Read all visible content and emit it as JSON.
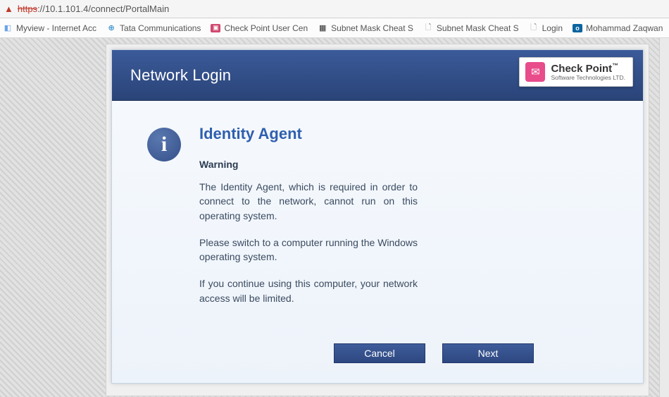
{
  "address": {
    "scheme": "https",
    "rest": "://10.1.101.4/connect/PortalMain"
  },
  "bookmarks": [
    {
      "label": "Myview - Internet Acc",
      "icon": "generic",
      "color": "#6aa3e8"
    },
    {
      "label": "Tata Communications",
      "icon": "globe",
      "color": "#1679c4"
    },
    {
      "label": "Check Point User Cen",
      "icon": "cp",
      "color": "#d1476e"
    },
    {
      "label": "Subnet Mask Cheat S",
      "icon": "grid",
      "color": "#2b2b2b"
    },
    {
      "label": "Subnet Mask Cheat S",
      "icon": "page",
      "color": "#888"
    },
    {
      "label": "Login",
      "icon": "page",
      "color": "#888"
    },
    {
      "label": "Mohammad Zaqwan",
      "icon": "outlook",
      "color": "#0a64a0"
    }
  ],
  "banner": {
    "title": "Network Login"
  },
  "brand": {
    "name": "Check Point",
    "tm": "™",
    "sub": "Software Technologies LTD."
  },
  "message": {
    "title": "Identity Agent",
    "subtitle": "Warning",
    "p1": "The Identity Agent, which is required in order to connect to the network, cannot run on this operating system.",
    "p2": "Please switch to a computer running the Windows operating system.",
    "p3": "If you continue using this computer, your network access will be limited."
  },
  "buttons": {
    "cancel": "Cancel",
    "next": "Next"
  }
}
